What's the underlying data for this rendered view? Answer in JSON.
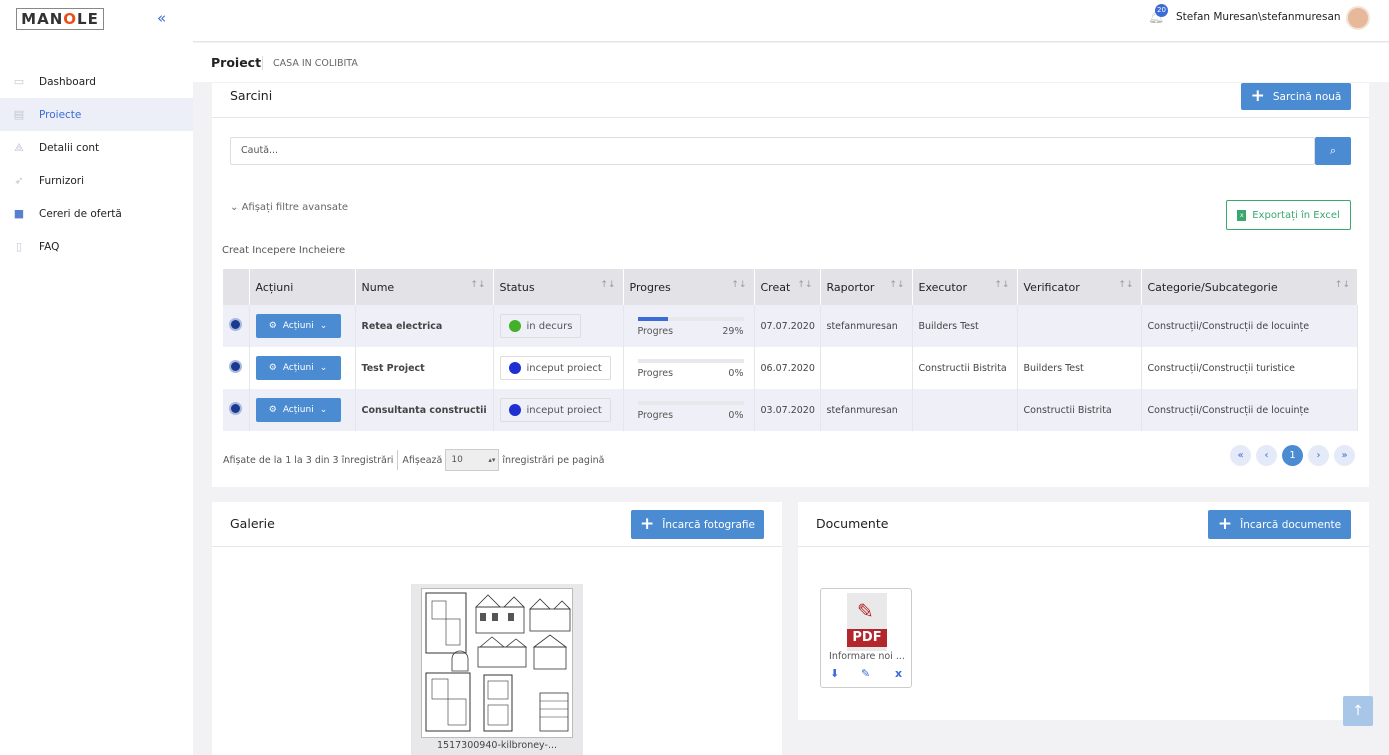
{
  "app": {
    "logo": "MANOLE",
    "collapse_icon": "double-chevron-left-icon"
  },
  "sidebar": {
    "items": [
      {
        "label": "Dashboard",
        "icon": "dashboard-icon"
      },
      {
        "label": "Proiecte",
        "icon": "clipboard-icon",
        "active": true
      },
      {
        "label": "Detalii cont",
        "icon": "user-tree-icon"
      },
      {
        "label": "Furnizori",
        "icon": "truck-icon"
      },
      {
        "label": "Cereri de ofertă",
        "icon": "briefcase-icon"
      },
      {
        "label": "FAQ",
        "icon": "document-icon"
      }
    ]
  },
  "topbar": {
    "notif_count": "20",
    "username": "Stefan Muresan\\stefanmuresan"
  },
  "breadcrumb": {
    "title": "Proiect",
    "project": "CASA IN COLIBITA"
  },
  "tasks": {
    "title": "Sarcini",
    "new_button": "Sarcină nouă",
    "search_placeholder": "Caută...",
    "filters_toggle": "Afișați filtre avansate",
    "export_button": "Exportați în Excel",
    "date_filters": "Creat Incepere Incheiere",
    "columns": [
      "Acțiuni",
      "Nume",
      "Status",
      "Progres",
      "Creat",
      "Raportor",
      "Executor",
      "Verificator",
      "Categorie/Subcategorie"
    ],
    "action_label": "Acțiuni",
    "progress_label": "Progres",
    "rows": [
      {
        "name": "Retea electrica",
        "status": "in decurs",
        "status_color": "#43b02a",
        "progress": 29,
        "progress_text": "29%",
        "created": "07.07.2020",
        "reporter": "stefanmuresan",
        "executor": "Builders Test",
        "verifier": "",
        "category": "Construcții/Construcții de locuințe"
      },
      {
        "name": "Test Project",
        "status": "inceput proiect",
        "status_color": "#1f2fd1",
        "progress": 0,
        "progress_text": "0%",
        "created": "06.07.2020",
        "reporter": "",
        "executor": "Constructii Bistrita",
        "verifier": "Builders Test",
        "category": "Construcții/Construcții turistice"
      },
      {
        "name": "Consultanta constructii",
        "status": "inceput proiect",
        "status_color": "#1f2fd1",
        "progress": 0,
        "progress_text": "0%",
        "created": "03.07.2020",
        "reporter": "stefanmuresan",
        "executor": "",
        "verifier": "Constructii Bistrita",
        "category": "Construcții/Construcții de locuințe"
      }
    ],
    "pager": {
      "info": "Afișate de la 1 la 3 din 3 înregistrări",
      "show": "Afișează",
      "page_size": "10",
      "per_page": "înregistrări pe pagină",
      "current": "1"
    }
  },
  "gallery": {
    "title": "Galerie",
    "upload_button": "Încarcă fotografie",
    "caption": "1517300940-kilbroney-..."
  },
  "documents": {
    "title": "Documente",
    "upload_button": "Încarcă documente",
    "doc_name": "Informare noi ...",
    "pdf_label": "PDF"
  }
}
